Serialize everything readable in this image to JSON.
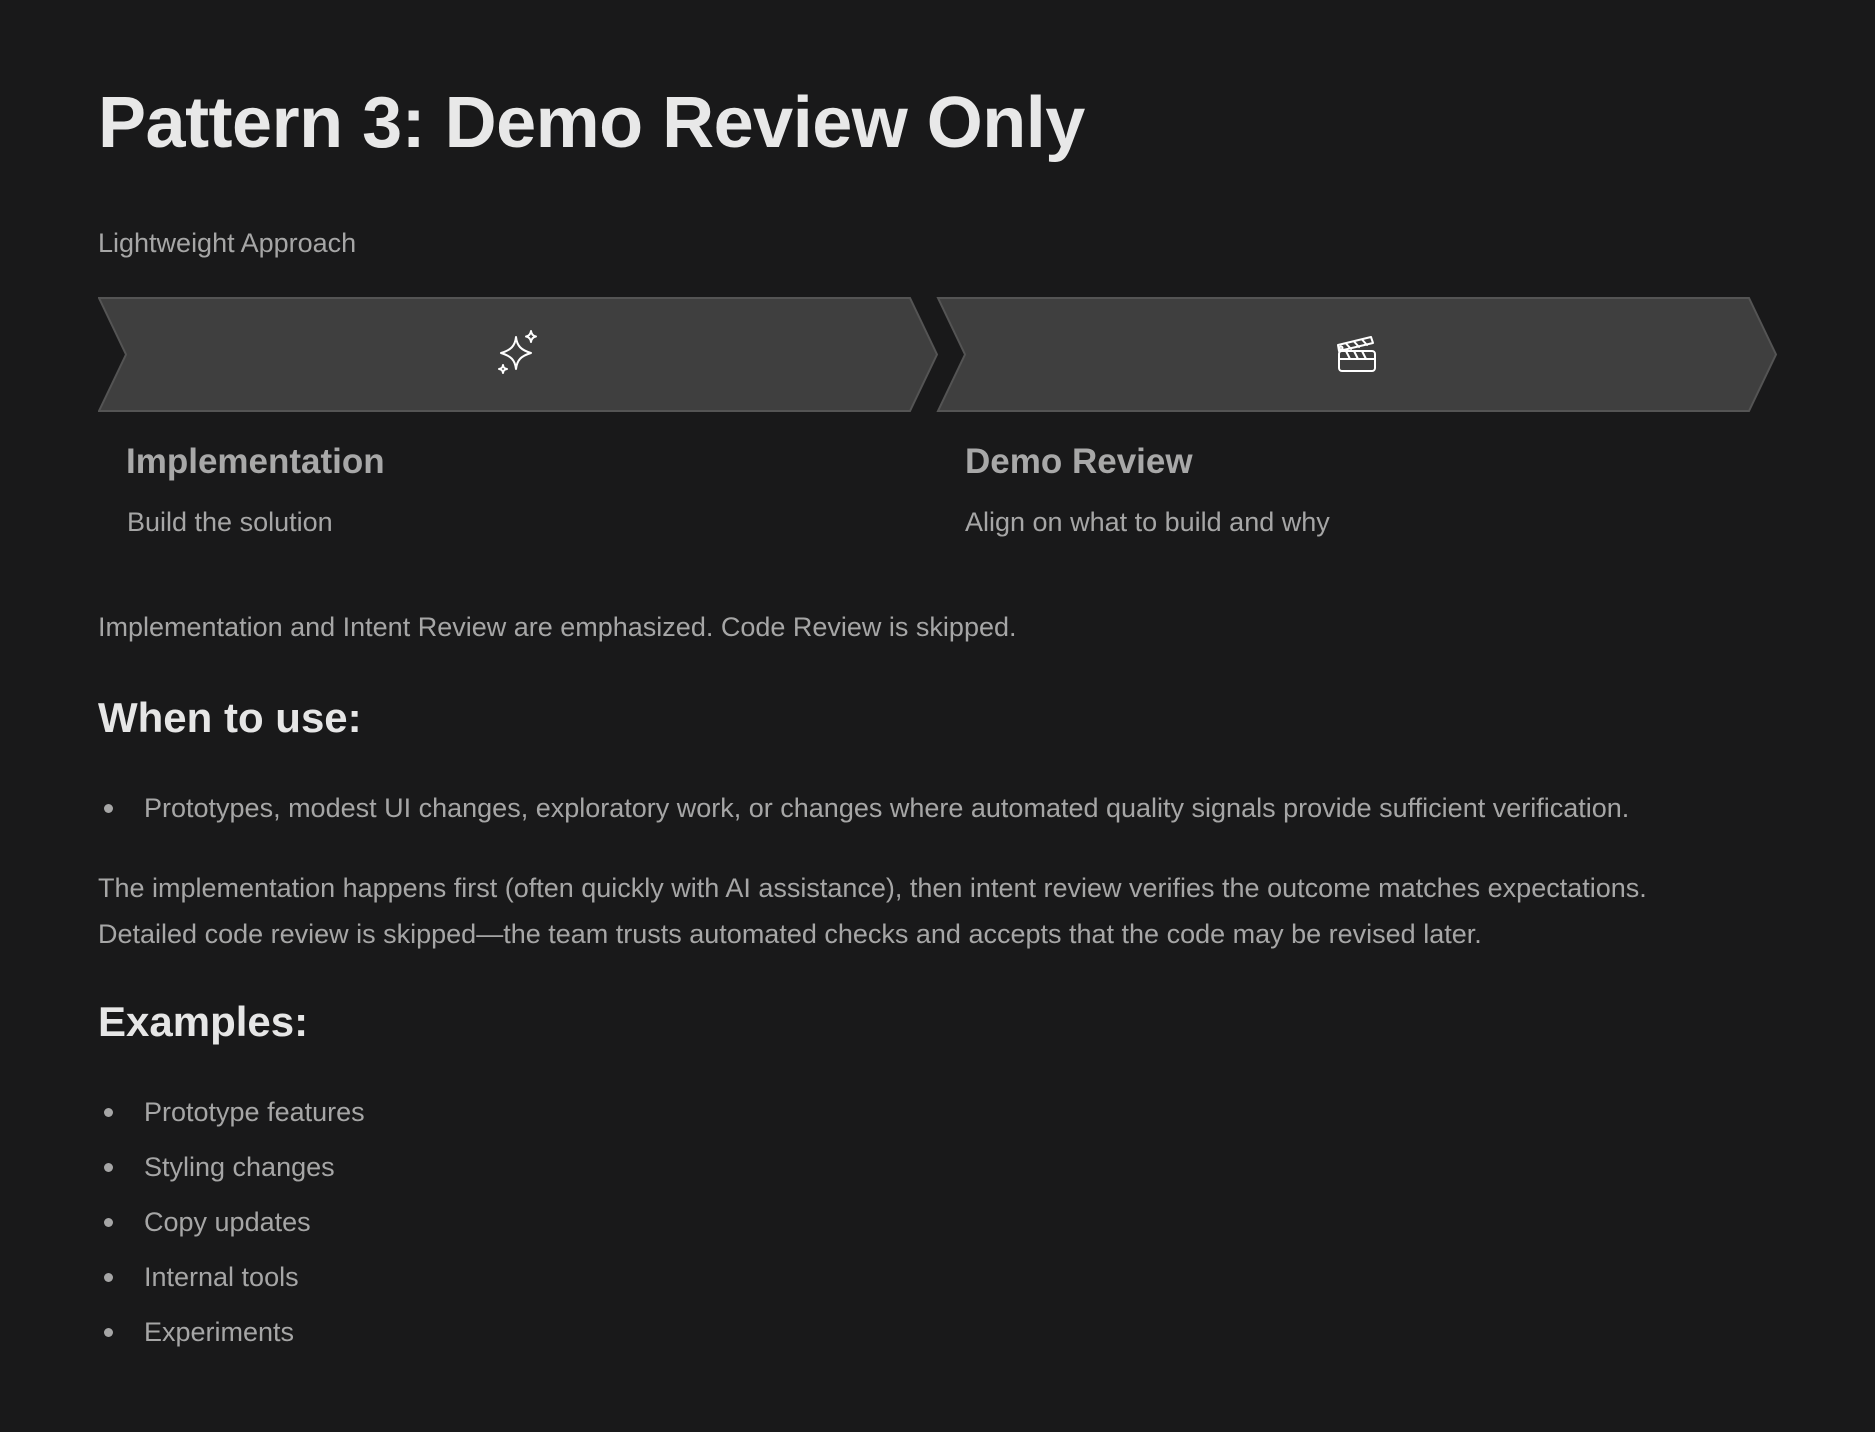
{
  "page": {
    "title": "Pattern 3: Demo Review Only",
    "subtitle": "Lightweight Approach"
  },
  "flow": {
    "steps": [
      {
        "icon": "sparkles-icon",
        "title": "Implementation",
        "description": "Build the solution"
      },
      {
        "icon": "clapperboard-icon",
        "title": "Demo Review",
        "description": "Align on what to build and why"
      }
    ],
    "colors": {
      "arrow_fill": "#3f3f3f",
      "arrow_stroke": "#545454",
      "icon": "#ffffff"
    }
  },
  "summary": "Implementation and Intent Review are emphasized. Code Review is skipped.",
  "when_to_use": {
    "heading": "When to use:",
    "items": [
      "Prototypes, modest UI changes, exploratory work, or changes where automated quality signals provide sufficient verification."
    ]
  },
  "explanation": {
    "line1": "The implementation happens first (often quickly with AI assistance), then intent review verifies the outcome matches expectations.",
    "line2": "Detailed code review is skipped—the team trusts automated checks and accepts that the code may be revised later."
  },
  "examples": {
    "heading": "Examples:",
    "items": [
      "Prototype features",
      "Styling changes",
      "Copy updates",
      "Internal tools",
      "Experiments"
    ]
  },
  "theme": {
    "background": "#19191a",
    "heading_text": "#e6e6e6",
    "body_text": "#a6a6a6"
  }
}
